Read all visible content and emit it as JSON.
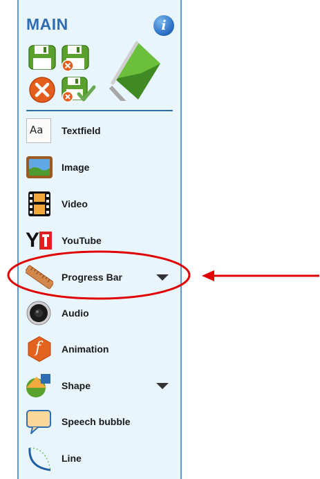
{
  "panel": {
    "title": "MAIN",
    "info_icon": "info-icon",
    "toolbar": [
      {
        "name": "save-icon",
        "color": "#5aa02c"
      },
      {
        "name": "save-close-icon",
        "color": "#5aa02c"
      },
      {
        "name": "close-icon",
        "color": "#e35d1d"
      },
      {
        "name": "save-check-icon",
        "color": "#5aa02c"
      },
      {
        "name": "flag-icon",
        "color": "#4a8f25"
      }
    ],
    "items": [
      {
        "label": "Textfield",
        "icon": "textfield-icon"
      },
      {
        "label": "Image",
        "icon": "image-icon"
      },
      {
        "label": "Video",
        "icon": "video-icon"
      },
      {
        "label": "YouTube",
        "icon": "youtube-icon"
      },
      {
        "label": "Progress Bar",
        "icon": "ruler-icon",
        "has_dropdown": true,
        "highlighted": true
      },
      {
        "label": "Audio",
        "icon": "speaker-icon"
      },
      {
        "label": "Animation",
        "icon": "animation-icon"
      },
      {
        "label": "Shape",
        "icon": "shape-icon",
        "has_dropdown": true
      },
      {
        "label": "Speech bubble",
        "icon": "speech-bubble-icon"
      },
      {
        "label": "Line",
        "icon": "line-icon"
      }
    ],
    "textfield_glyph": "Aa",
    "youtube_glyph": "Y",
    "animation_glyph": "f"
  },
  "annotation": {
    "highlight_color": "#e00000"
  }
}
